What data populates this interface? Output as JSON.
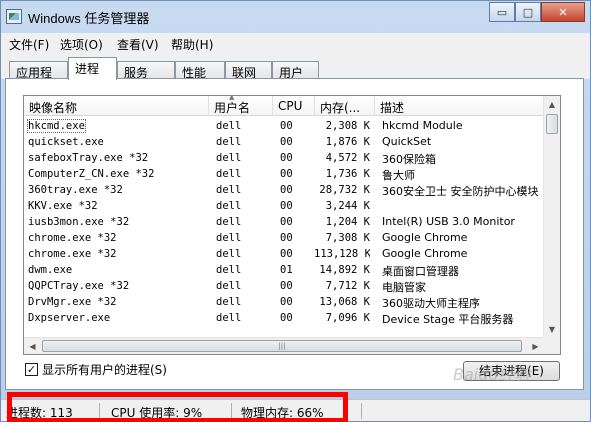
{
  "window": {
    "title": "Windows 任务管理器",
    "caption_min": "▭",
    "caption_max": "□",
    "caption_close": "✕"
  },
  "menu": [
    "文件(F)",
    "选项(O)",
    "查看(V)",
    "帮助(H)"
  ],
  "tabs": [
    {
      "label": "应用程序",
      "active": false
    },
    {
      "label": "进程",
      "active": true
    },
    {
      "label": "服务",
      "active": false
    },
    {
      "label": "性能",
      "active": false
    },
    {
      "label": "联网",
      "active": false
    },
    {
      "label": "用户",
      "active": false
    }
  ],
  "columns": [
    "映像名称",
    "用户名",
    "CPU",
    "内存(...",
    "描述"
  ],
  "processes": [
    {
      "name": "hkcmd.exe",
      "user": "dell",
      "cpu": "00",
      "mem": "2,308 K",
      "desc": "hkcmd Module"
    },
    {
      "name": "quickset.exe",
      "user": "dell",
      "cpu": "00",
      "mem": "1,876 K",
      "desc": "QuickSet"
    },
    {
      "name": "safeboxTray.exe *32",
      "user": "dell",
      "cpu": "00",
      "mem": "4,572 K",
      "desc": "360保险箱"
    },
    {
      "name": "ComputerZ_CN.exe *32",
      "user": "dell",
      "cpu": "00",
      "mem": "1,736 K",
      "desc": "鲁大师"
    },
    {
      "name": "360tray.exe *32",
      "user": "dell",
      "cpu": "00",
      "mem": "28,732 K",
      "desc": "360安全卫士 安全防护中心模块"
    },
    {
      "name": "KKV.exe *32",
      "user": "dell",
      "cpu": "00",
      "mem": "3,244 K",
      "desc": ""
    },
    {
      "name": "iusb3mon.exe *32",
      "user": "dell",
      "cpu": "00",
      "mem": "1,204 K",
      "desc": "Intel(R) USB 3.0 Monitor"
    },
    {
      "name": "chrome.exe *32",
      "user": "dell",
      "cpu": "00",
      "mem": "7,308 K",
      "desc": "Google Chrome"
    },
    {
      "name": "chrome.exe *32",
      "user": "dell",
      "cpu": "00",
      "mem": "113,128 K",
      "desc": "Google Chrome"
    },
    {
      "name": "dwm.exe",
      "user": "dell",
      "cpu": "01",
      "mem": "14,892 K",
      "desc": "桌面窗口管理器"
    },
    {
      "name": "QQPCTray.exe *32",
      "user": "dell",
      "cpu": "00",
      "mem": "7,712 K",
      "desc": "电脑管家"
    },
    {
      "name": "DrvMgr.exe *32",
      "user": "dell",
      "cpu": "00",
      "mem": "13,068 K",
      "desc": "360驱动大师主程序"
    },
    {
      "name": "Dxpserver.exe",
      "user": "dell",
      "cpu": "00",
      "mem": "7,096 K",
      "desc": "Device Stage 平台服务器"
    }
  ],
  "show_all_label": "显示所有用户的进程(S)",
  "show_all_checked": "✓",
  "end_process_label": "结束进程(E)",
  "status": {
    "process_count": "进程数: 113",
    "cpu_usage": "CPU 使用率: 9%",
    "physical_memory": "物理内存: 66%"
  },
  "watermark_text": "Baidu经验",
  "colors": {
    "highlight": "#ff0000",
    "titlebar": "#c8daf0"
  }
}
